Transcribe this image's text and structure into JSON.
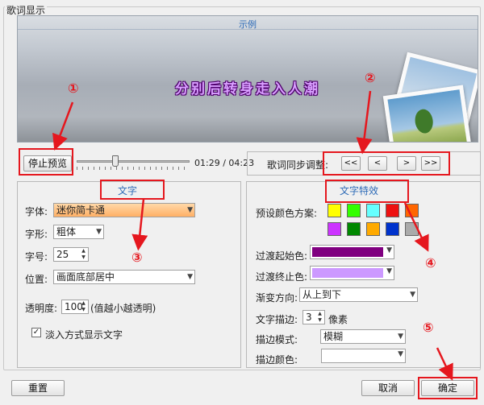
{
  "window": {
    "title": "歌词显示"
  },
  "preview": {
    "label": "示例",
    "lyric": "分别后转身走入人潮"
  },
  "playback": {
    "stop_label": "停止预览",
    "time": "01:29 / 04:23",
    "progress": 0.34
  },
  "sync": {
    "label": "歌词同步调整:",
    "buttons": [
      "<<",
      "<",
      ">",
      ">>"
    ]
  },
  "text_panel": {
    "title": "文字",
    "font_label": "字体:",
    "font_value": "迷你简卡通",
    "style_label": "字形:",
    "style_value": "粗体",
    "size_label": "字号:",
    "size_value": "25",
    "position_label": "位置:",
    "position_value": "画面底部居中",
    "opacity_label": "透明度:",
    "opacity_value": "100",
    "opacity_hint": "(值越小越透明)",
    "fade_label": "淡入方式显示文字",
    "fade_checked": true
  },
  "effect_panel": {
    "title": "文字特效",
    "preset_label": "预设颜色方案:",
    "preset_colors": [
      "#ffff00",
      "#33ff00",
      "#66ffff",
      "#ee1111",
      "#ff6600",
      "#cc33ff",
      "#008800",
      "#ffaa00",
      "#0033cc",
      "#aaaaaa"
    ],
    "start_label": "过渡起始色:",
    "start_color": "#800080",
    "end_label": "过渡终止色:",
    "end_color": "#cc99ff",
    "direction_label": "渐变方向:",
    "direction_value": "从上到下",
    "stroke_label": "文字描边:",
    "stroke_value": "3",
    "stroke_unit": "像素",
    "stroke_mode_label": "描边模式:",
    "stroke_mode_value": "模糊",
    "stroke_color_label": "描边颜色:",
    "stroke_color": "#ffffff"
  },
  "footer": {
    "reset_label": "重置",
    "cancel_label": "取消",
    "ok_label": "确定"
  },
  "annotations": {
    "colors": {
      "red": "#e5171e"
    },
    "markers": [
      "①",
      "②",
      "③",
      "④",
      "⑤"
    ]
  }
}
